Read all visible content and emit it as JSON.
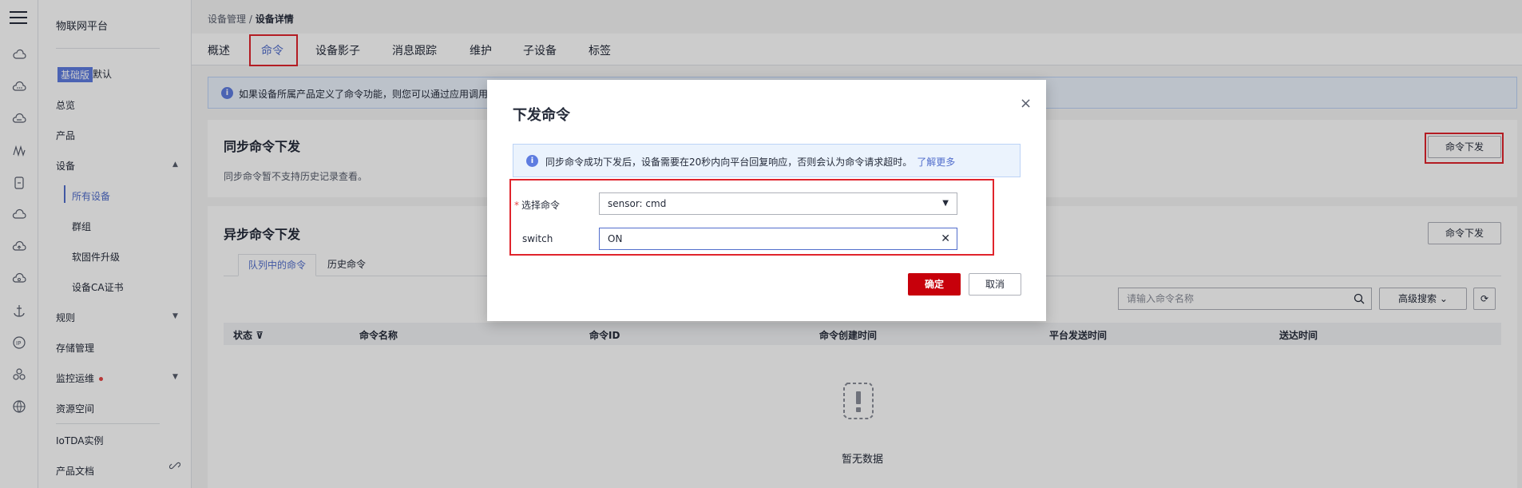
{
  "sidebar": {
    "platform_title": "物联网平台",
    "badge": "基础版",
    "default_label": "默认",
    "items": {
      "overview": "总览",
      "product": "产品",
      "device": "设备",
      "all_devices": "所有设备",
      "group": "群组",
      "firmware": "软固件升级",
      "ca_cert": "设备CA证书",
      "rules": "规则",
      "storage": "存储管理",
      "monitoring": "监控运维",
      "resource_space": "资源空间",
      "iotda_instance": "IoTDA实例",
      "product_docs": "产品文档"
    }
  },
  "breadcrumb": {
    "parent": "设备管理",
    "separator": " / ",
    "current": "设备详情"
  },
  "tabs": [
    "概述",
    "命令",
    "设备影子",
    "消息跟踪",
    "维护",
    "子设备",
    "标签"
  ],
  "main": {
    "info_text": "如果设备所属产品定义了命令功能，则您可以通过应用调用",
    "sync": {
      "title": "同步命令下发",
      "hint": "同步命令暂不支持历史记录查看。",
      "button": "命令下发"
    },
    "async": {
      "title": "异步命令下发",
      "button": "命令下发",
      "subtabs": [
        "队列中的命令",
        "历史命令"
      ],
      "search_placeholder": "请输入命令名称",
      "adv_search": "高级搜索",
      "columns": [
        "状态",
        "命令名称",
        "命令ID",
        "命令创建时间",
        "平台发送时间",
        "送达时间"
      ],
      "empty_text": "暂无数据"
    }
  },
  "dialog": {
    "title": "下发命令",
    "tip": "同步命令成功下发后，设备需要在20秒内向平台回复响应，否则会认为命令请求超时。",
    "tip_link": "了解更多",
    "select_label": "选择命令",
    "select_value": "sensor: cmd",
    "switch_label": "switch",
    "switch_value": "ON",
    "confirm": "确定",
    "cancel": "取消"
  }
}
